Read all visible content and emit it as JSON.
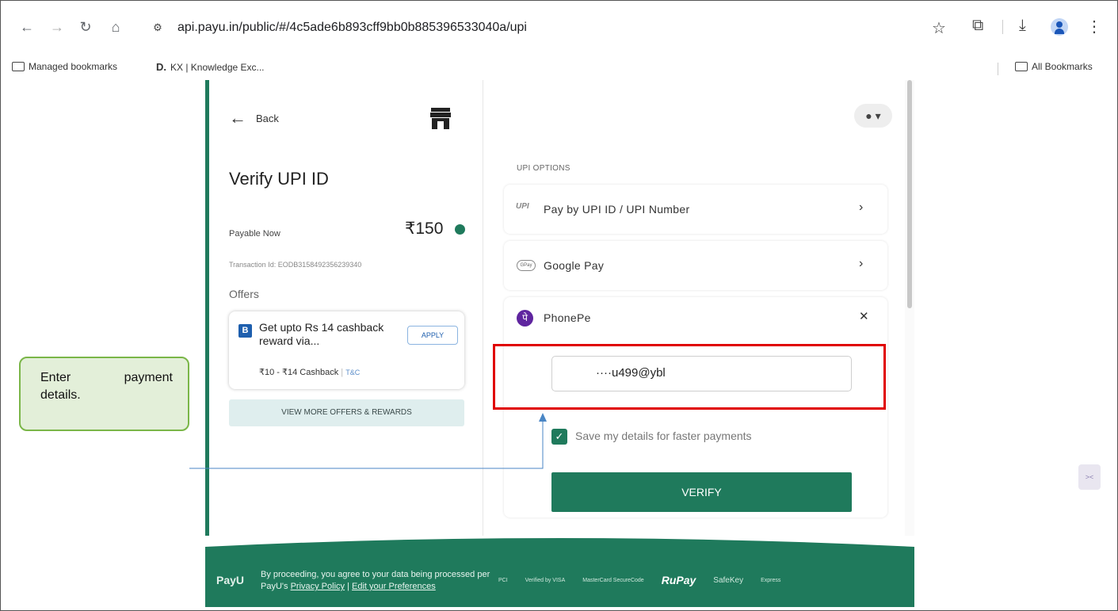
{
  "browser": {
    "url": "api.payu.in/public/#/4c5ade6b893cff9bb0b885396533040a/upi",
    "bookmarks": [
      {
        "label": "Managed bookmarks"
      },
      {
        "prefix": "D.",
        "label": "KX | Knowledge Exc..."
      }
    ],
    "all_bookmarks": "All Bookmarks"
  },
  "left_panel": {
    "back_label": "Back",
    "title": "Verify UPI ID",
    "payable_label": "Payable Now",
    "payable_amount": "₹150",
    "transaction": "Transaction Id: EODB3158492356239340",
    "offers_label": "Offers",
    "offer": {
      "logo_letter": "B",
      "title": "Get upto Rs 14 cashback reward via...",
      "cashback": "₹10 - ₹14 Cashback",
      "tc": "T&C",
      "apply_label": "APPLY"
    },
    "view_more_label": "VIEW MORE OFFERS & REWARDS"
  },
  "right_panel": {
    "section_label": "UPI OPTIONS",
    "options": [
      {
        "icon": "UPI",
        "label": "Pay by UPI ID / UPI Number"
      },
      {
        "icon": "GPay",
        "label": "Google Pay"
      },
      {
        "icon": "पे",
        "label": "PhonePe"
      }
    ],
    "upi_input_value": "····u499@ybl",
    "save_label": "Save my details for faster payments",
    "verify_label": "VERIFY"
  },
  "footer": {
    "brand": "PayU",
    "consent_line1": "By proceeding, you agree to your data being processed per",
    "consent_prefix": "PayU's ",
    "privacy_link": "Privacy Policy",
    "separator": " | ",
    "preferences_link": "Edit your Preferences",
    "badges": [
      "PCI",
      "Verified by VISA",
      "MasterCard SecureCode",
      "RuPay",
      "SafeKey",
      "Express"
    ]
  },
  "callout": {
    "line1_a": "Enter",
    "line1_b": "payment",
    "line2": "details."
  },
  "colors": {
    "brand_green": "#1f7a5c",
    "highlight_red": "#e00000",
    "callout_fill": "#e3efd9",
    "callout_border": "#7ab648"
  }
}
